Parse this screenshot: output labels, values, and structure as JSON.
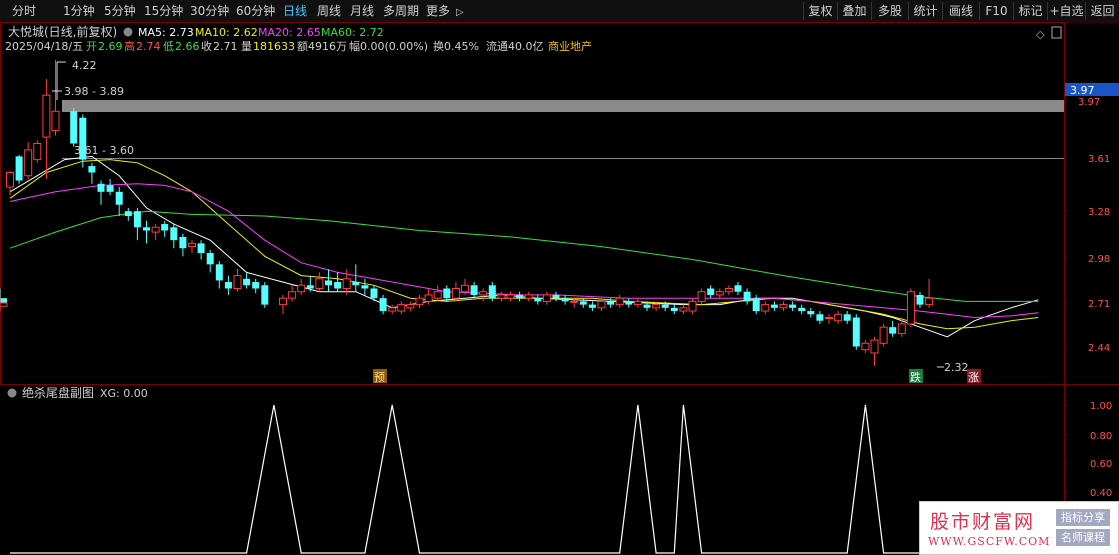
{
  "toolbar": {
    "periods": [
      "分时",
      "1分钟",
      "5分钟",
      "15分钟",
      "30分钟",
      "60分钟",
      "日线",
      "周线",
      "月线",
      "多周期",
      "更多"
    ],
    "active_period": "日线",
    "more_arrow": "▷",
    "right_buttons": [
      "复权",
      "叠加",
      "多股",
      "统计",
      "画线",
      "F10",
      "标记",
      "+自选",
      "返回"
    ]
  },
  "info": {
    "stock_title": "大悦城(日线,前复权)",
    "ma5": "MA5: 2.73",
    "ma10": "MA10: 2.62",
    "ma20": "MA20: 2.65",
    "ma60": "MA60: 2.72",
    "date": "2025/04/18/五",
    "open_label": "开",
    "open": "2.69",
    "high_label": "高",
    "high": "2.74",
    "low_label": "低",
    "low": "2.66",
    "close_label": "收",
    "close": "2.71",
    "vol_label": "量",
    "vol": "181633",
    "amount": "额4916万",
    "change": "幅0.00(0.00%)",
    "turnover": "换0.45%",
    "float": "流通40.0亿",
    "sector": "商业地产",
    "diamond_icon": "◇"
  },
  "annotations": {
    "high_peak": "4.22",
    "zone_upper": "3.98 - 3.89",
    "zone_lower": "3.61 - 3.60",
    "low_point": "2.32",
    "price_tag": "3.97",
    "marker_yu": "预",
    "marker_die": "跌",
    "marker_zhang": "涨"
  },
  "sub_panel": {
    "title": "绝杀尾盘副图",
    "xg": "XG: 0.00"
  },
  "watermark": {
    "title": "股市财富网",
    "url": "WWW.GSCFW.COM",
    "tag1": "指标分享",
    "tag2": "名师课程"
  },
  "chart_data": [
    {
      "type": "candlestick",
      "name": "main",
      "price_axis": {
        "ticks": [
          3.97,
          3.61,
          3.28,
          2.98,
          2.71,
          2.44
        ],
        "range": [
          2.2,
          4.42
        ]
      },
      "bar_index_range": [
        0,
        115
      ],
      "candles": [
        [
          3.43,
          3.52,
          3.38,
          3.53
        ],
        [
          3.62,
          3.47,
          3.45,
          3.63
        ],
        [
          3.5,
          3.66,
          3.48,
          3.71
        ],
        [
          3.6,
          3.7,
          3.58,
          3.72
        ],
        [
          3.74,
          4.0,
          3.48,
          4.1
        ],
        [
          3.78,
          3.9,
          3.75,
          4.22
        ],
        [
          3.9,
          3.7,
          3.68,
          3.92
        ],
        [
          3.86,
          3.6,
          3.55,
          3.88
        ],
        [
          3.56,
          3.52,
          3.45,
          3.58
        ],
        [
          3.45,
          3.4,
          3.32,
          3.47
        ],
        [
          3.44,
          3.4,
          3.38,
          3.48
        ],
        [
          3.4,
          3.32,
          3.25,
          3.43
        ],
        [
          3.28,
          3.25,
          3.22,
          3.3
        ],
        [
          3.28,
          3.18,
          3.1,
          3.3
        ],
        [
          3.18,
          3.16,
          3.08,
          3.22
        ],
        [
          3.15,
          3.18,
          3.1,
          3.2
        ],
        [
          3.2,
          3.16,
          3.12,
          3.22
        ],
        [
          3.18,
          3.1,
          3.05,
          3.2
        ],
        [
          3.12,
          3.05,
          3.0,
          3.14
        ],
        [
          3.06,
          3.08,
          3.02,
          3.1
        ],
        [
          3.08,
          3.02,
          2.98,
          3.1
        ],
        [
          3.02,
          2.95,
          2.9,
          3.04
        ],
        [
          2.95,
          2.85,
          2.8,
          2.97
        ],
        [
          2.84,
          2.8,
          2.76,
          2.88
        ],
        [
          2.8,
          2.88,
          2.78,
          2.92
        ],
        [
          2.86,
          2.82,
          2.8,
          2.9
        ],
        [
          2.84,
          2.8,
          2.77,
          2.86
        ],
        [
          2.82,
          2.7,
          2.68,
          2.84
        ],
        [
          2.7,
          2.74,
          2.64,
          2.76
        ],
        [
          2.74,
          2.78,
          2.72,
          2.82
        ],
        [
          2.78,
          2.82,
          2.76,
          2.86
        ],
        [
          2.82,
          2.8,
          2.78,
          2.88
        ],
        [
          2.8,
          2.86,
          2.78,
          2.9
        ],
        [
          2.85,
          2.82,
          2.78,
          2.92
        ],
        [
          2.84,
          2.8,
          2.78,
          2.9
        ],
        [
          2.8,
          2.86,
          2.76,
          2.92
        ],
        [
          2.84,
          2.82,
          2.78,
          2.95
        ],
        [
          2.82,
          2.8,
          2.76,
          2.86
        ],
        [
          2.8,
          2.74,
          2.72,
          2.82
        ],
        [
          2.74,
          2.66,
          2.64,
          2.76
        ],
        [
          2.66,
          2.68,
          2.64,
          2.7
        ],
        [
          2.66,
          2.7,
          2.64,
          2.72
        ],
        [
          2.68,
          2.7,
          2.66,
          2.72
        ],
        [
          2.7,
          2.74,
          2.68,
          2.76
        ],
        [
          2.72,
          2.76,
          2.7,
          2.8
        ],
        [
          2.74,
          2.78,
          2.72,
          2.82
        ],
        [
          2.8,
          2.74,
          2.72,
          2.82
        ],
        [
          2.74,
          2.8,
          2.72,
          2.84
        ],
        [
          2.78,
          2.82,
          2.76,
          2.86
        ],
        [
          2.82,
          2.76,
          2.74,
          2.84
        ],
        [
          2.76,
          2.78,
          2.72,
          2.8
        ],
        [
          2.82,
          2.74,
          2.72,
          2.84
        ],
        [
          2.74,
          2.76,
          2.72,
          2.78
        ],
        [
          2.74,
          2.76,
          2.72,
          2.78
        ],
        [
          2.76,
          2.74,
          2.72,
          2.78
        ],
        [
          2.74,
          2.76,
          2.72,
          2.78
        ],
        [
          2.74,
          2.72,
          2.7,
          2.76
        ],
        [
          2.72,
          2.76,
          2.7,
          2.78
        ],
        [
          2.76,
          2.74,
          2.72,
          2.78
        ],
        [
          2.74,
          2.72,
          2.7,
          2.76
        ],
        [
          2.72,
          2.72,
          2.68,
          2.74
        ],
        [
          2.72,
          2.7,
          2.68,
          2.74
        ],
        [
          2.7,
          2.68,
          2.66,
          2.72
        ],
        [
          2.68,
          2.72,
          2.66,
          2.74
        ],
        [
          2.72,
          2.7,
          2.68,
          2.74
        ],
        [
          2.7,
          2.74,
          2.68,
          2.76
        ],
        [
          2.72,
          2.7,
          2.68,
          2.74
        ],
        [
          2.7,
          2.72,
          2.68,
          2.74
        ],
        [
          2.7,
          2.68,
          2.66,
          2.72
        ],
        [
          2.68,
          2.7,
          2.66,
          2.72
        ],
        [
          2.7,
          2.68,
          2.66,
          2.72
        ],
        [
          2.68,
          2.66,
          2.64,
          2.7
        ],
        [
          2.66,
          2.68,
          2.64,
          2.7
        ],
        [
          2.66,
          2.72,
          2.64,
          2.74
        ],
        [
          2.72,
          2.78,
          2.7,
          2.8
        ],
        [
          2.8,
          2.76,
          2.74,
          2.82
        ],
        [
          2.76,
          2.78,
          2.74,
          2.8
        ],
        [
          2.78,
          2.8,
          2.76,
          2.82
        ],
        [
          2.82,
          2.78,
          2.76,
          2.84
        ],
        [
          2.78,
          2.72,
          2.7,
          2.8
        ],
        [
          2.74,
          2.66,
          2.64,
          2.76
        ],
        [
          2.66,
          2.7,
          2.64,
          2.72
        ],
        [
          2.7,
          2.68,
          2.66,
          2.72
        ],
        [
          2.68,
          2.7,
          2.66,
          2.72
        ],
        [
          2.7,
          2.68,
          2.66,
          2.72
        ],
        [
          2.68,
          2.66,
          2.64,
          2.7
        ],
        [
          2.66,
          2.64,
          2.62,
          2.68
        ],
        [
          2.64,
          2.6,
          2.58,
          2.66
        ],
        [
          2.62,
          2.62,
          2.58,
          2.64
        ],
        [
          2.6,
          2.64,
          2.58,
          2.66
        ],
        [
          2.64,
          2.6,
          2.58,
          2.66
        ],
        [
          2.62,
          2.44,
          2.42,
          2.64
        ],
        [
          2.42,
          2.46,
          2.4,
          2.48
        ],
        [
          2.4,
          2.48,
          2.32,
          2.5
        ],
        [
          2.46,
          2.56,
          2.44,
          2.58
        ],
        [
          2.56,
          2.52,
          2.5,
          2.6
        ],
        [
          2.52,
          2.58,
          2.5,
          2.62
        ],
        [
          2.58,
          2.78,
          2.56,
          2.8
        ],
        [
          2.76,
          2.7,
          2.68,
          2.78
        ],
        [
          2.7,
          2.74,
          2.68,
          2.86
        ],
        [
          2.74,
          2.71,
          2.66,
          2.8
        ],
        [
          2.69,
          2.71,
          2.66,
          2.74
        ]
      ],
      "candle_slots": [
        0,
        1,
        2,
        3,
        4,
        5,
        7,
        8,
        9,
        10,
        11,
        12,
        13,
        14,
        15,
        16,
        17,
        18,
        19,
        20,
        21,
        22,
        23,
        24,
        25,
        26,
        27,
        28,
        30,
        31,
        32,
        33,
        34,
        35,
        36,
        37,
        38,
        39,
        40,
        41,
        42,
        43,
        44,
        45,
        46,
        47,
        48,
        49,
        50,
        51,
        52,
        53,
        54,
        55,
        56,
        57,
        58,
        59,
        60,
        61,
        62,
        63,
        64,
        65,
        66,
        67,
        68,
        69,
        70,
        71,
        72,
        73,
        74,
        75,
        76,
        77,
        78,
        79,
        80,
        81,
        82,
        83,
        84,
        85,
        86,
        87,
        88,
        89,
        90,
        91,
        92,
        93,
        94,
        95,
        96,
        97,
        98,
        99,
        100,
        101
      ],
      "series": [
        {
          "name": "MA5",
          "color": "#ffffff",
          "x": [
            0,
            3,
            6,
            9,
            12,
            15,
            18,
            22,
            26,
            30,
            34,
            38,
            42,
            46,
            50,
            54,
            58,
            62,
            66,
            70,
            74,
            78,
            82,
            86,
            90,
            94,
            97,
            100,
            103,
            106,
            110,
            113
          ],
          "y": [
            3.4,
            3.5,
            3.6,
            3.62,
            3.5,
            3.3,
            3.2,
            3.1,
            2.9,
            2.84,
            2.78,
            2.78,
            2.68,
            2.72,
            2.74,
            2.76,
            2.74,
            2.73,
            2.72,
            2.71,
            2.7,
            2.7,
            2.74,
            2.74,
            2.7,
            2.66,
            2.62,
            2.56,
            2.5,
            2.6,
            2.68,
            2.73
          ]
        },
        {
          "name": "MA10",
          "color": "#f0f000",
          "x": [
            0,
            4,
            8,
            11,
            14,
            17,
            20,
            24,
            28,
            32,
            36,
            40,
            44,
            48,
            52,
            56,
            60,
            64,
            68,
            72,
            76,
            80,
            84,
            88,
            92,
            96,
            100,
            103,
            106,
            110,
            113
          ],
          "y": [
            3.36,
            3.52,
            3.59,
            3.6,
            3.58,
            3.5,
            3.4,
            3.2,
            3.0,
            2.88,
            2.86,
            2.82,
            2.74,
            2.72,
            2.74,
            2.74,
            2.74,
            2.74,
            2.72,
            2.71,
            2.7,
            2.72,
            2.74,
            2.72,
            2.68,
            2.64,
            2.58,
            2.55,
            2.56,
            2.6,
            2.62
          ]
        },
        {
          "name": "MA20",
          "color": "#ff3cff",
          "x": [
            0,
            5,
            10,
            14,
            17,
            20,
            24,
            28,
            32,
            36,
            40,
            44,
            48,
            52,
            56,
            60,
            64,
            68,
            72,
            76,
            80,
            84,
            88,
            92,
            96,
            100,
            103,
            106,
            110,
            113
          ],
          "y": [
            3.34,
            3.4,
            3.44,
            3.45,
            3.44,
            3.4,
            3.28,
            3.1,
            2.96,
            2.9,
            2.86,
            2.82,
            2.78,
            2.77,
            2.76,
            2.76,
            2.75,
            2.74,
            2.74,
            2.74,
            2.74,
            2.74,
            2.72,
            2.7,
            2.68,
            2.66,
            2.64,
            2.62,
            2.63,
            2.65
          ]
        },
        {
          "name": "MA60",
          "color": "#39e039",
          "x": [
            0,
            5,
            10,
            15,
            20,
            28,
            35,
            45,
            55,
            65,
            75,
            85,
            95,
            100,
            105,
            110,
            113
          ],
          "y": [
            3.05,
            3.15,
            3.24,
            3.28,
            3.26,
            3.25,
            3.22,
            3.16,
            3.12,
            3.06,
            2.98,
            2.88,
            2.79,
            2.75,
            2.72,
            2.72,
            2.72
          ]
        }
      ]
    },
    {
      "type": "line",
      "name": "sub",
      "y_axis": {
        "ticks": [
          1.0,
          0.8,
          0.6,
          0.4
        ],
        "range": [
          0,
          1.15
        ]
      },
      "series": [
        {
          "name": "XG",
          "color": "#ffffff",
          "x": [
            0,
            26,
            29,
            32,
            39,
            42,
            45,
            67,
            69,
            71,
            72,
            73,
            74,
            76,
            92,
            94,
            96,
            115
          ],
          "y": [
            0,
            0,
            1,
            0,
            0,
            1,
            0,
            0,
            1,
            0,
            0,
            0,
            1,
            0,
            0,
            1,
            0,
            0
          ]
        }
      ]
    }
  ]
}
